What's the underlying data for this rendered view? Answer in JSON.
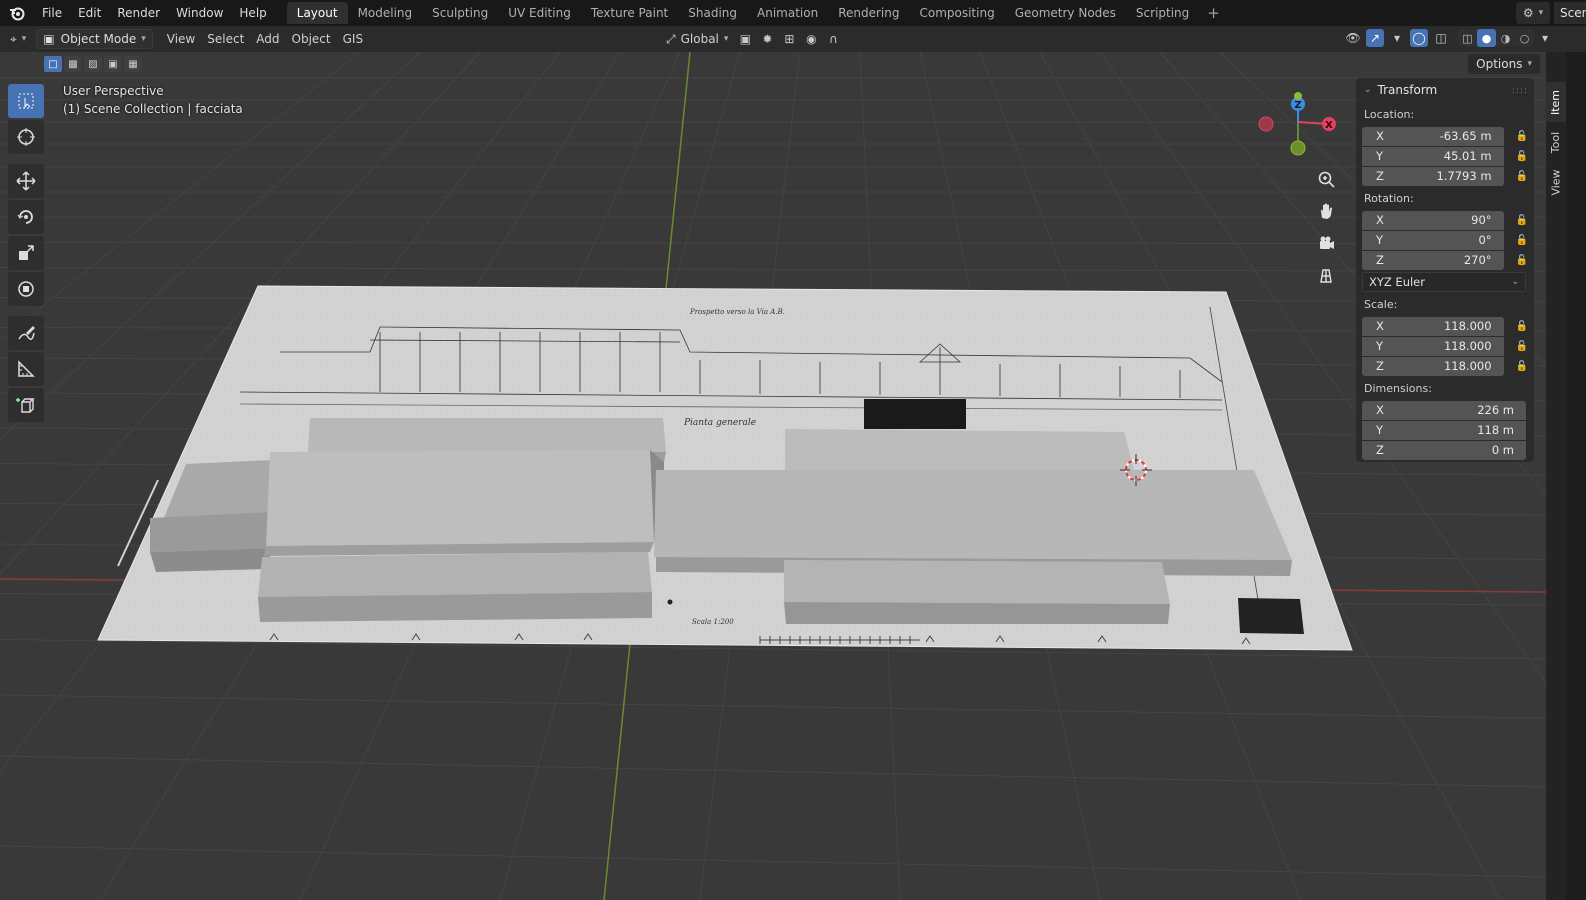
{
  "topbar": {
    "menus": [
      "File",
      "Edit",
      "Render",
      "Window",
      "Help"
    ],
    "workspaces": [
      "Layout",
      "Modeling",
      "Sculpting",
      "UV Editing",
      "Texture Paint",
      "Shading",
      "Animation",
      "Rendering",
      "Compositing",
      "Geometry Nodes",
      "Scripting"
    ],
    "active_workspace": "Layout",
    "add_tab": "+",
    "scene_name": "Scen"
  },
  "viewport_header": {
    "mode": "Object Mode",
    "menus": [
      "View",
      "Select",
      "Add",
      "Object",
      "GIS"
    ],
    "transform_orientation": "Global"
  },
  "viewport": {
    "perspective": "User Perspective",
    "collection_info": "(1) Scene Collection | facciata",
    "options_label": "Options",
    "drawing_title": "Prospetto verso la Via A.B.",
    "drawing_subtitle": "Pianta generale",
    "scale_note": "Scala 1:200"
  },
  "gizmo": {
    "z_label": "Z",
    "x_label": "X"
  },
  "transform_panel": {
    "title": "Transform",
    "location_label": "Location:",
    "location": [
      {
        "axis": "X",
        "value": "-63.65 m"
      },
      {
        "axis": "Y",
        "value": "45.01 m"
      },
      {
        "axis": "Z",
        "value": "1.7793 m"
      }
    ],
    "rotation_label": "Rotation:",
    "rotation": [
      {
        "axis": "X",
        "value": "90°"
      },
      {
        "axis": "Y",
        "value": "0°"
      },
      {
        "axis": "Z",
        "value": "270°"
      }
    ],
    "rotation_mode": "XYZ Euler",
    "scale_label": "Scale:",
    "scale": [
      {
        "axis": "X",
        "value": "118.000"
      },
      {
        "axis": "Y",
        "value": "118.000"
      },
      {
        "axis": "Z",
        "value": "118.000"
      }
    ],
    "dimensions_label": "Dimensions:",
    "dimensions": [
      {
        "axis": "X",
        "value": "226 m"
      },
      {
        "axis": "Y",
        "value": "118 m"
      },
      {
        "axis": "Z",
        "value": "0 m"
      }
    ]
  },
  "side_tabs": [
    "Item",
    "Tool",
    "View"
  ],
  "colors": {
    "accent": "#4772b3",
    "axis_x": "#e5405e",
    "axis_y": "#8bbb3b",
    "axis_z": "#3e8ddf"
  }
}
